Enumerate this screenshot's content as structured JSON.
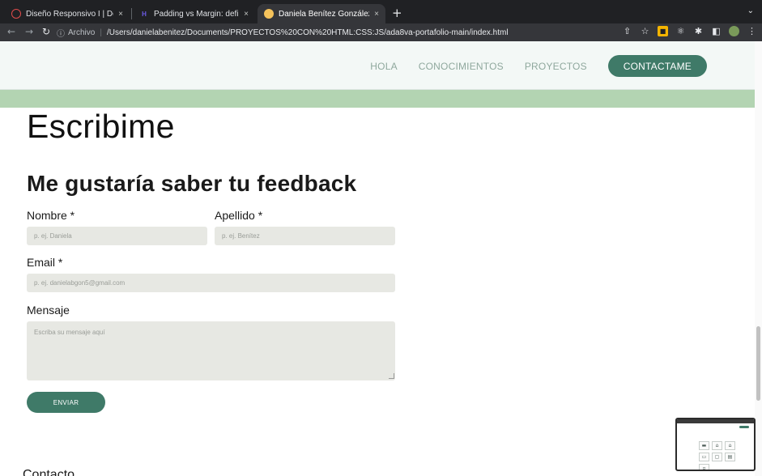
{
  "browser": {
    "tabs": [
      {
        "title": "Diseño Responsivo I | Desarrollo",
        "active": false,
        "favicon_color": "#e04b4b",
        "favicon_icon": "circle-icon"
      },
      {
        "title": "Padding vs Margin: definición,",
        "active": false,
        "favicon_color": "#6c5ce7",
        "favicon_icon": "h-logo-icon"
      },
      {
        "title": "Daniela Benítez González",
        "active": true,
        "favicon_color": "#f4c25b",
        "favicon_icon": "avatar-icon"
      }
    ],
    "new_tab_glyph": "+",
    "close_glyph": "×",
    "url_prefix": "Archivo",
    "url": "/Users/danielabenitez/Documents/PROYECTOS%20CON%20HTML:CSS:JS/ada8va-portafolio-main/index.html"
  },
  "site": {
    "nav": {
      "items": [
        "HOLA",
        "CONOCIMIENTOS",
        "PROYECTOS"
      ],
      "cta": "CONTACTAME"
    },
    "colors": {
      "accent": "#3f7a68",
      "band": "#b3d4b2",
      "header_bg": "#f3f8f6",
      "input_bg": "#e7e8e3"
    },
    "page_title": "Escribime",
    "form": {
      "title": "Me gustaría saber tu feedback",
      "first_name_label": "Nombre *",
      "first_name_placeholder": "p. ej. Daniela",
      "last_name_label": "Apellido *",
      "last_name_placeholder": "p. ej. Benítez",
      "email_label": "Email *",
      "email_placeholder": "p. ej. danielabgon5@gmail.com",
      "message_label": "Mensaje",
      "message_placeholder": "Escriba su mensaje aquí",
      "submit_label": "ENVIAR"
    },
    "footer_partial": "Contacto"
  }
}
